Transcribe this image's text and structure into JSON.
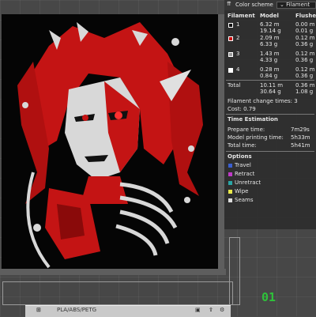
{
  "legend": {
    "title": "Color scheme",
    "scheme_value": "Filament",
    "columns": {
      "filament": "Filament",
      "model": "Model",
      "flushed": "Flushed"
    },
    "rows": [
      {
        "index": "1",
        "color": "#111111",
        "model_m": "6.32 m",
        "model_g": "19.14 g",
        "flushed_m": "0.00 m",
        "flushed_g": "0.01 g"
      },
      {
        "index": "2",
        "color": "#cc1111",
        "model_m": "2.09 m",
        "model_g": "6.33 g",
        "flushed_m": "0.12 m",
        "flushed_g": "0.36 g"
      },
      {
        "index": "3",
        "color": "#9a9a9a",
        "model_m": "1.43 m",
        "model_g": "4.33 g",
        "flushed_m": "0.12 m",
        "flushed_g": "0.36 g"
      },
      {
        "index": "4",
        "color": "#ffffff",
        "model_m": "0.28 m",
        "model_g": "0.84 g",
        "flushed_m": "0.12 m",
        "flushed_g": "0.36 g"
      }
    ],
    "total": {
      "label": "Total",
      "model_m": "10.11 m",
      "model_g": "30.64 g",
      "flushed_m": "0.36 m",
      "flushed_g": "1.08 g"
    },
    "filament_change": "Filament change times: 3",
    "cost": "Cost: 0.79",
    "time_heading": "Time Estimation",
    "prepare_label": "Prepare time:",
    "prepare_value": "7m29s",
    "model_time_label": "Model printing time:",
    "model_time_value": "5h33m",
    "total_time_label": "Total time:",
    "total_time_value": "5h41m",
    "options_heading": "Options",
    "options": [
      {
        "label": "Travel",
        "color": "#3a5fd0"
      },
      {
        "label": "Retract",
        "color": "#c03ac8"
      },
      {
        "label": "Unretract",
        "color": "#2aa6a6"
      },
      {
        "label": "Wipe",
        "color": "#e8e84a"
      },
      {
        "label": "Seams",
        "color": "#dddddd"
      }
    ]
  },
  "toolbar": {
    "filament_label": "PLA/ABS/PETG"
  },
  "plate": {
    "number": "01"
  }
}
